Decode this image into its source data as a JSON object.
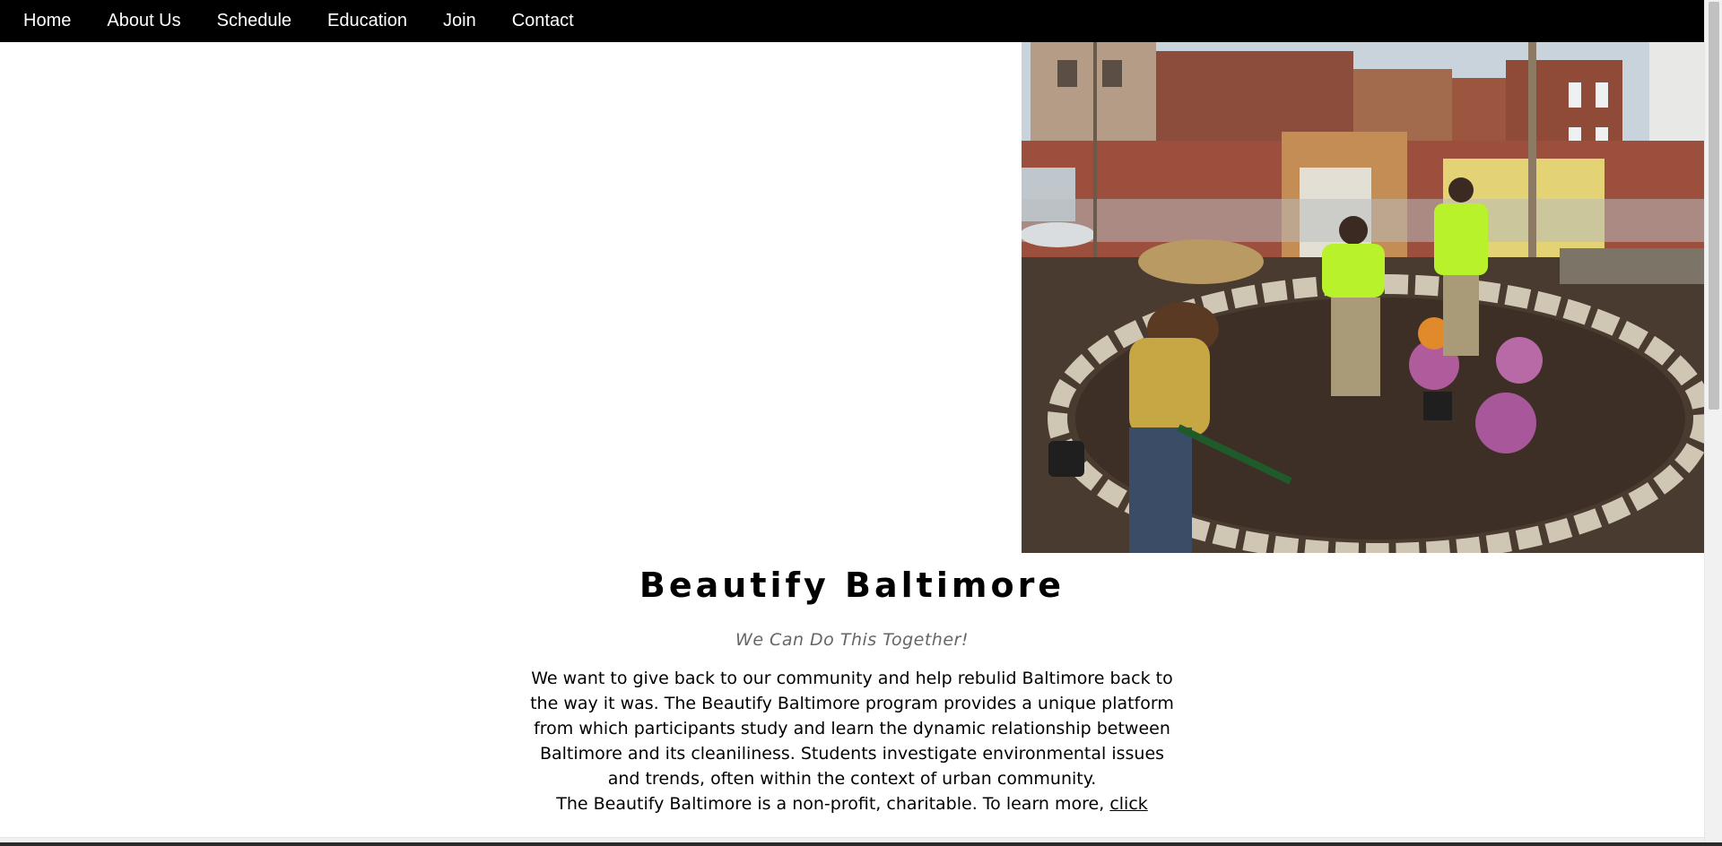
{
  "nav": {
    "items": [
      {
        "label": "Home"
      },
      {
        "label": "About Us"
      },
      {
        "label": "Schedule"
      },
      {
        "label": "Education"
      },
      {
        "label": "Join"
      },
      {
        "label": "Contact"
      }
    ]
  },
  "hero": {
    "image_subject": "volunteers planting flowers in a circular stone garden bed in an urban lot"
  },
  "main": {
    "title": "Beautify Baltimore",
    "tagline": "We Can Do This Together!",
    "description": "We want to give back to our community and help rebulid Baltimore back to the way it was. The Beautify Baltimore program provides a unique platform from which participants study and learn the dynamic relationship between Baltimore and its cleaniliness. Students investigate environmental issues and trends, often within the context of urban community.",
    "nonprofit_text": "The Beautify Baltimore is a non-profit, charitable. To learn more, ",
    "link_label": "click"
  },
  "colors": {
    "nav_bg": "#000000",
    "nav_text": "#ffffff",
    "tagline": "#666666",
    "body_text": "#000000"
  }
}
